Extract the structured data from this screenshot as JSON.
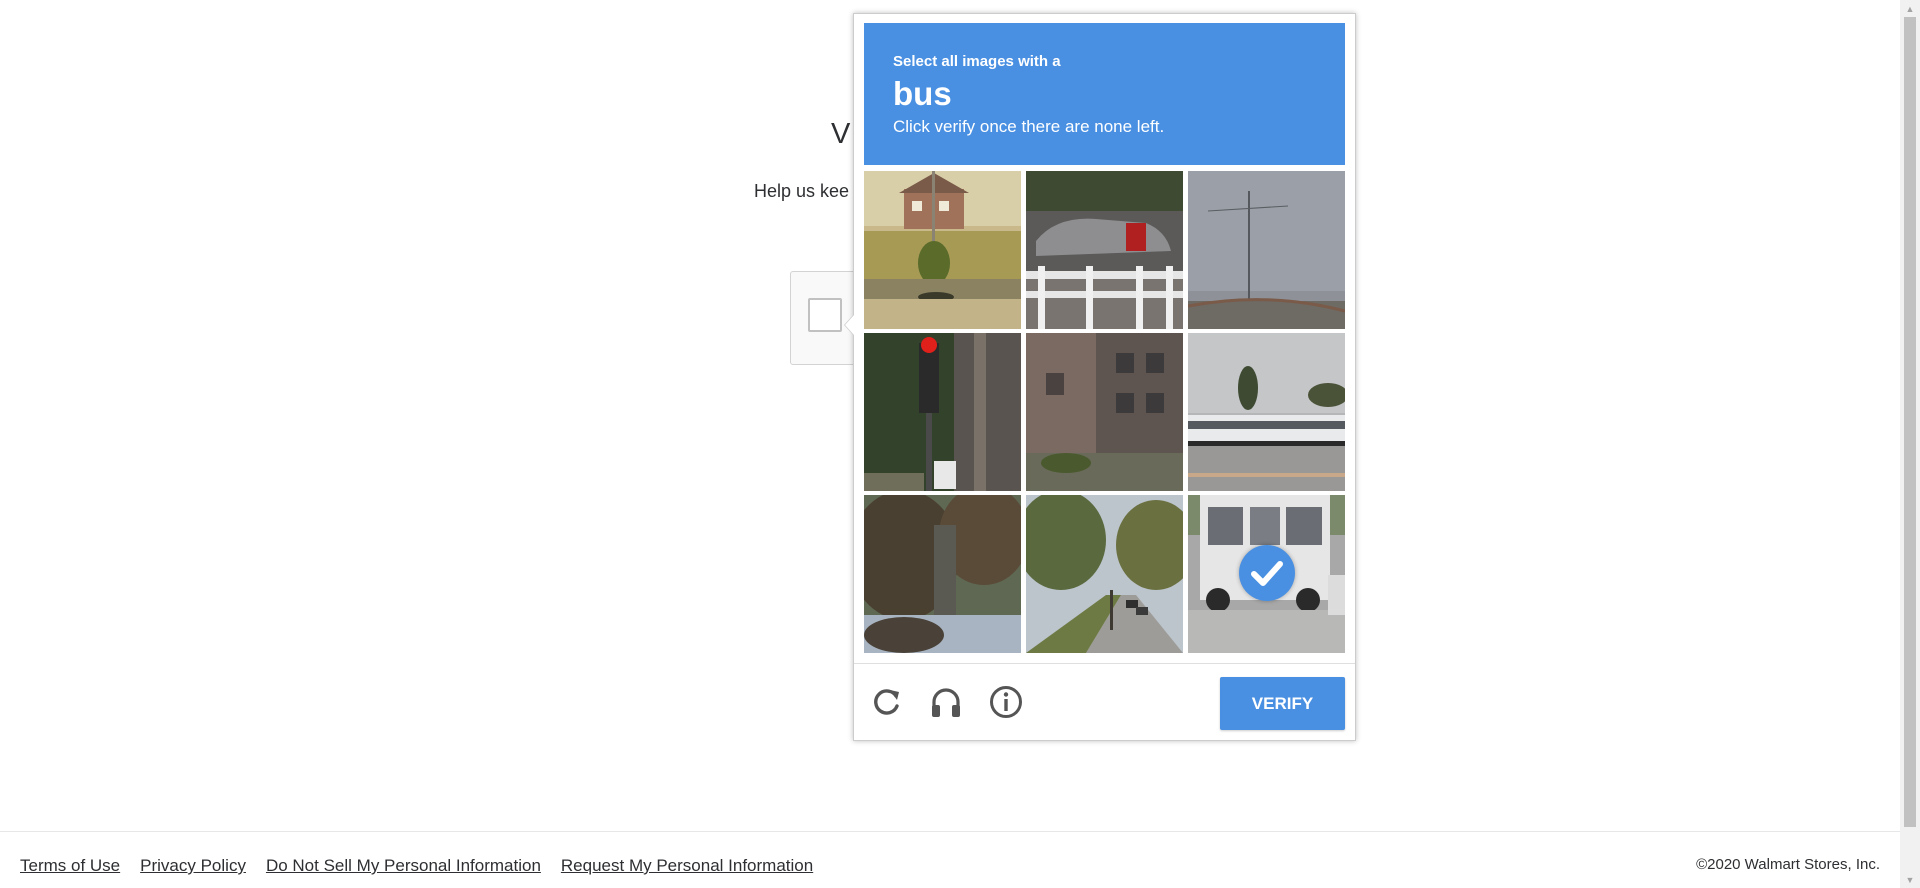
{
  "page": {
    "heading_partial": "V",
    "subtext_partial": "Help us kee"
  },
  "captcha": {
    "instruction_line1": "Select all images with a",
    "target_object": "bus",
    "instruction_line3": "Click verify once there are none left.",
    "tiles": [
      {
        "index": 1,
        "scene": "house-tree-road",
        "selected": false
      },
      {
        "index": 2,
        "scene": "car-white-fence",
        "selected": false
      },
      {
        "index": 3,
        "scene": "sky-pole",
        "selected": false
      },
      {
        "index": 4,
        "scene": "traffic-light-ivy",
        "selected": false
      },
      {
        "index": 5,
        "scene": "brick-building",
        "selected": false
      },
      {
        "index": 6,
        "scene": "buses-parking-lot",
        "selected": false
      },
      {
        "index": 7,
        "scene": "traffic-light-tree",
        "selected": false
      },
      {
        "index": 8,
        "scene": "tree-lined-street",
        "selected": false
      },
      {
        "index": 9,
        "scene": "bus-street",
        "selected": true
      }
    ],
    "footer": {
      "reload_icon": "reload-icon",
      "audio_icon": "headphones-icon",
      "info_icon": "info-icon",
      "verify_label": "VERIFY"
    },
    "accent_color": "#4a90e2"
  },
  "footer": {
    "links": [
      "Terms of Use",
      "Privacy Policy",
      "Do Not Sell My Personal Information",
      "Request My Personal Information"
    ],
    "copyright": "©2020 Walmart Stores, Inc."
  }
}
